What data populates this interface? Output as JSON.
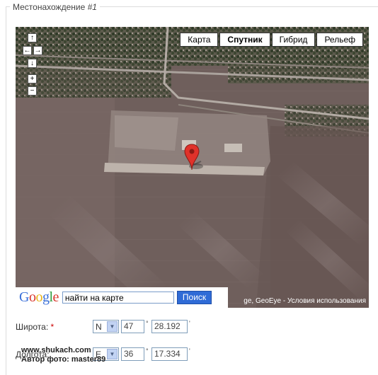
{
  "fieldset": {
    "legend_prefix": "Местонахождение ",
    "legend_index": "#1"
  },
  "map": {
    "nav": {
      "up": "↑",
      "left": "←",
      "right": "→",
      "down": "↓",
      "zoom_in": "+",
      "zoom_out": "−"
    },
    "types": [
      "Карта",
      "Спутник",
      "Гибрид",
      "Рельеф"
    ],
    "active_type": "Спутник",
    "search": {
      "logo": "Google",
      "value": "найти на карте",
      "button": "Поиск"
    },
    "copyright": "ge, GeoEye - Условия использования",
    "colors": {
      "marker": "#e0322a",
      "search_button": "#2f6bd6"
    }
  },
  "latitude": {
    "label": "Широта:",
    "required_mark": "*",
    "hemisphere": "N",
    "degrees": "47",
    "minutes": "28.192",
    "deg_symbol": "°",
    "min_symbol": "'"
  },
  "longitude": {
    "label": "Долгота:",
    "hemisphere": "E",
    "degrees": "36",
    "minutes": "17.334",
    "deg_symbol": "°",
    "min_symbol": "'"
  },
  "watermark": {
    "site": "www.shukach.com",
    "author": "Автор фото: master89"
  }
}
